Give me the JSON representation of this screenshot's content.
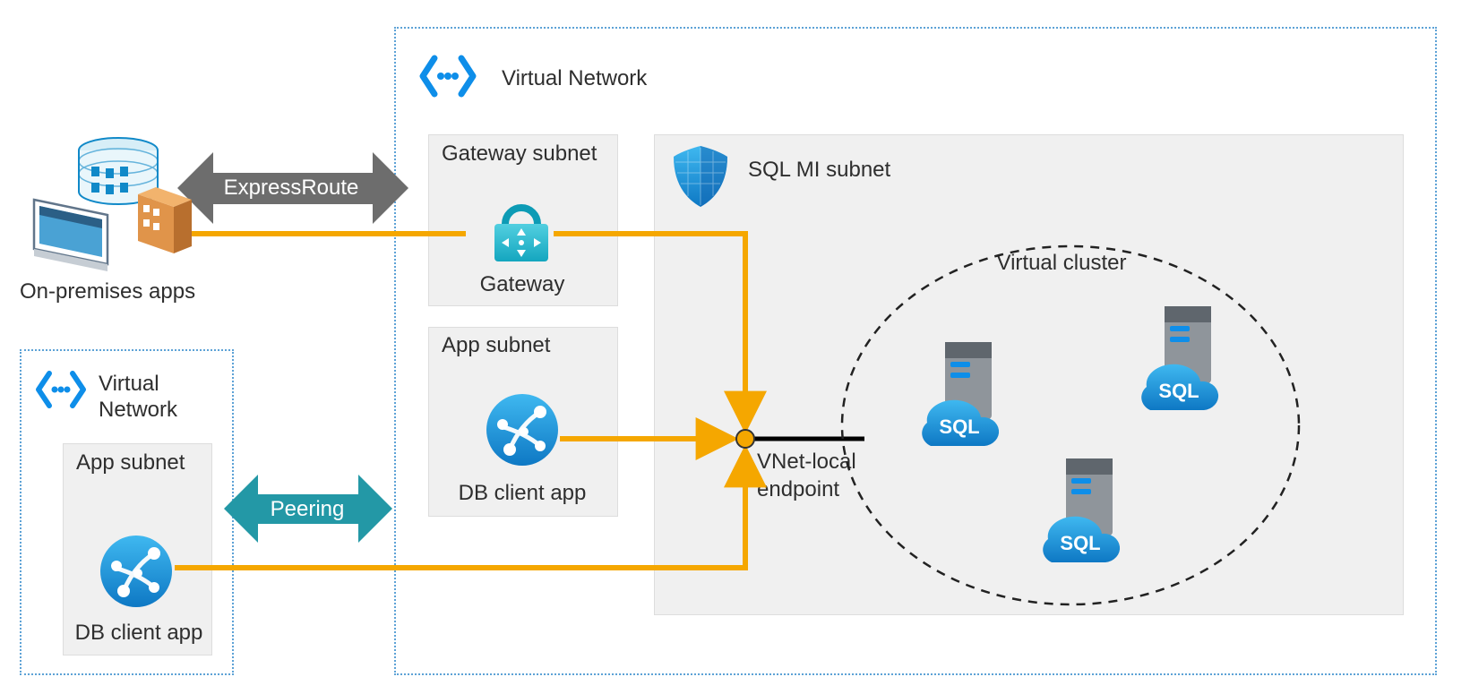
{
  "vnet_main_label": "Virtual Network",
  "vnet_peer_label": "Virtual Network",
  "gateway_subnet_label": "Gateway subnet",
  "gateway_label": "Gateway",
  "app_subnet_main_label": "App subnet",
  "app_subnet_peer_label": "App subnet",
  "db_client_main_label": "DB client app",
  "db_client_peer_label": "DB client app",
  "on_prem_label": "On-premises apps",
  "expressroute_label": "ExpressRoute",
  "peering_label": "Peering",
  "sql_mi_subnet_label": "SQL MI subnet",
  "virtual_cluster_label": "Virtual cluster",
  "endpoint_label": "VNet-local endpoint",
  "sql_badge_text": "SQL",
  "colors": {
    "orange": "#f5a700",
    "azure_blue": "#0e8ee9",
    "teal": "#2398a6",
    "darkgrey": "#6d6d6d"
  }
}
